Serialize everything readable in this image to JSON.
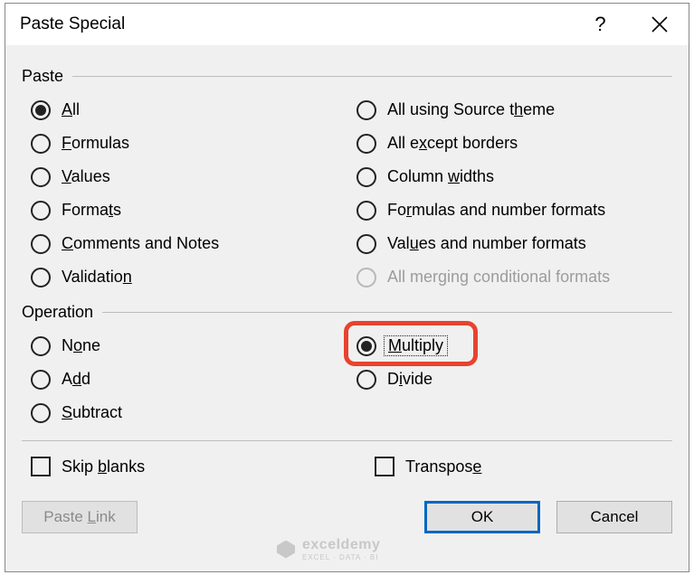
{
  "title": "Paste Special",
  "groups": {
    "paste": {
      "label": "Paste",
      "left": [
        {
          "pre": "",
          "u": "A",
          "post": "ll",
          "checked": true
        },
        {
          "pre": "",
          "u": "F",
          "post": "ormulas",
          "checked": false
        },
        {
          "pre": "",
          "u": "V",
          "post": "alues",
          "checked": false
        },
        {
          "pre": "Forma",
          "u": "t",
          "post": "s",
          "checked": false
        },
        {
          "pre": "",
          "u": "C",
          "post": "omments and Notes",
          "checked": false
        },
        {
          "pre": "Validatio",
          "u": "n",
          "post": "",
          "checked": false
        }
      ],
      "right": [
        {
          "pre": "All using Source t",
          "u": "h",
          "post": "eme",
          "checked": false
        },
        {
          "pre": "All e",
          "u": "x",
          "post": "cept borders",
          "checked": false
        },
        {
          "pre": "Column ",
          "u": "w",
          "post": "idths",
          "checked": false
        },
        {
          "pre": "Fo",
          "u": "r",
          "post": "mulas and number formats",
          "checked": false
        },
        {
          "pre": "Val",
          "u": "u",
          "post": "es and number formats",
          "checked": false
        },
        {
          "pre": "All mer",
          "u": "g",
          "post": "ing conditional formats",
          "checked": false,
          "disabled": true
        }
      ]
    },
    "operation": {
      "label": "Operation",
      "left": [
        {
          "pre": "N",
          "u": "o",
          "post": "ne",
          "checked": false
        },
        {
          "pre": "A",
          "u": "d",
          "post": "d",
          "checked": false
        },
        {
          "pre": "",
          "u": "S",
          "post": "ubtract",
          "checked": false
        }
      ],
      "right": [
        {
          "pre": "",
          "u": "M",
          "post": "ultiply",
          "checked": true,
          "focused": true,
          "highlight": true
        },
        {
          "pre": "D",
          "u": "i",
          "post": "vide",
          "checked": false
        }
      ]
    }
  },
  "checks": {
    "left": {
      "pre": "Skip ",
      "u": "b",
      "post": "lanks",
      "checked": false
    },
    "right": {
      "pre": "Transpos",
      "u": "e",
      "post": "",
      "checked": false
    }
  },
  "buttons": {
    "paste_link": {
      "pre": "Paste ",
      "u": "L",
      "post": "ink"
    },
    "ok": "OK",
    "cancel": "Cancel"
  },
  "watermark": {
    "brand": "exceldemy",
    "sub": "EXCEL · DATA · BI"
  }
}
